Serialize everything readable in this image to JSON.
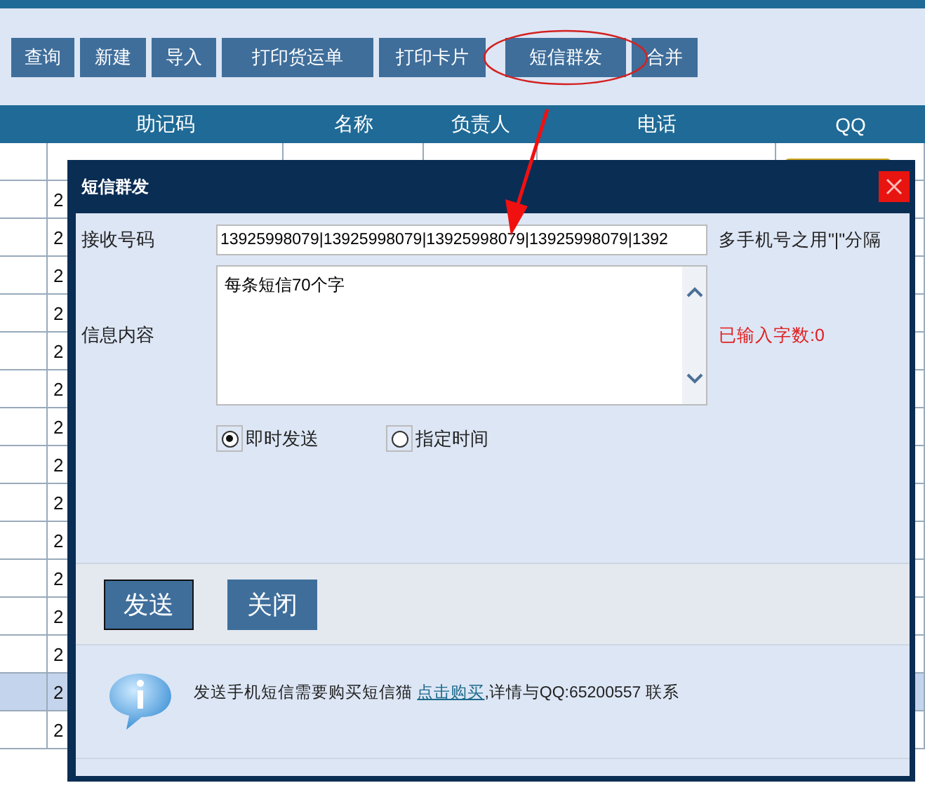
{
  "toolbar": {
    "buttons": [
      "查询",
      "新建",
      "导入",
      "打印货运单",
      "打印卡片",
      "短信群发",
      "合并"
    ]
  },
  "table": {
    "columns": [
      "助记码",
      "名称",
      "负责人",
      "电话",
      "QQ"
    ],
    "first_row": {
      "qq_badge": true
    },
    "rows": [
      {
        "cell": "2",
        "selected": false
      },
      {
        "cell": "2",
        "selected": false
      },
      {
        "cell": "2",
        "selected": false
      },
      {
        "cell": "2",
        "selected": false
      },
      {
        "cell": "2",
        "selected": false
      },
      {
        "cell": "2",
        "selected": false
      },
      {
        "cell": "2",
        "selected": false
      },
      {
        "cell": "2",
        "selected": false
      },
      {
        "cell": "2",
        "selected": false
      },
      {
        "cell": "2",
        "selected": false
      },
      {
        "cell": "2",
        "selected": false
      },
      {
        "cell": "2",
        "selected": false
      },
      {
        "cell": "2",
        "selected": false
      },
      {
        "cell": "2",
        "selected": true
      },
      {
        "cell": "2",
        "selected": false
      }
    ]
  },
  "dialog": {
    "title": "短信群发",
    "recipients": {
      "label": "接收号码",
      "value": "13925998079|13925998079|13925998079|13925998079|1392",
      "hint": "多手机号之用\"|\"分隔"
    },
    "message": {
      "label": "信息内容",
      "value": "每条短信70个字",
      "counter": "已输入字数:0"
    },
    "send_mode": [
      {
        "label": "即时发送",
        "selected": true
      },
      {
        "label": "指定时间",
        "selected": false
      }
    ],
    "buttons": [
      {
        "label": "发送",
        "focused": true
      },
      {
        "label": "关闭",
        "focused": false
      }
    ],
    "notice": {
      "text": "发送手机短信需要购买短信猫",
      "link": "点击购买",
      "rest": ",详情与QQ:65200557 联系"
    }
  }
}
